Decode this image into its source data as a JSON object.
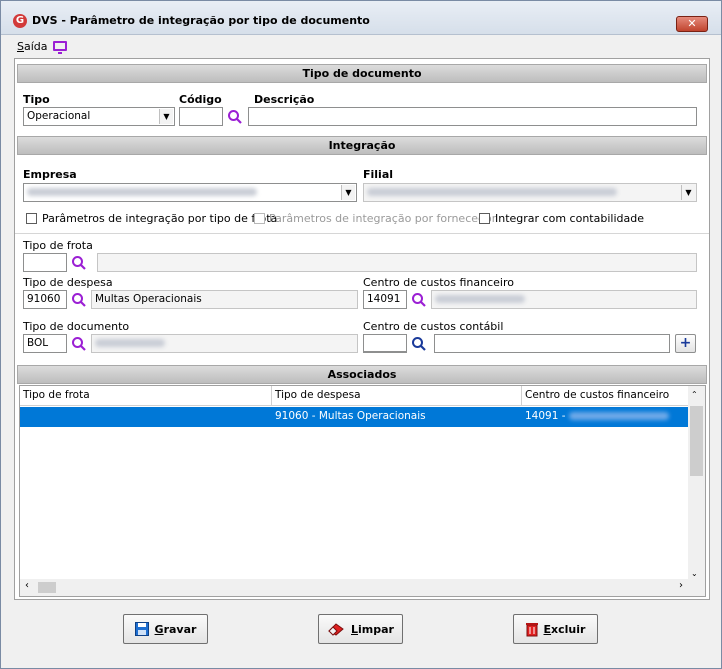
{
  "window": {
    "title": "DVS - Parâmetro de integração por tipo de documento",
    "close_glyph": "✕",
    "logo_glyph": "G"
  },
  "menu": {
    "saida": "Saída",
    "monitor_icon": "monitor-icon"
  },
  "tipo_documento_section": {
    "header": "Tipo de documento",
    "tipo_label": "Tipo",
    "tipo_value": "Operacional",
    "codigo_label": "Código",
    "codigo_value": "",
    "descricao_label": "Descrição",
    "descricao_value": ""
  },
  "integracao_section": {
    "header": "Integração",
    "empresa_label": "Empresa",
    "filial_label": "Filial",
    "chk_frota": "Parâmetros de integração por tipo de frota",
    "chk_fornecedor": "Parâmetros de integração por fornecedor",
    "chk_contabilidade": "Integrar com contabilidade",
    "tipo_frota_label": "Tipo de frota",
    "tipo_despesa_label": "Tipo de despesa",
    "tipo_despesa_code": "91060",
    "tipo_despesa_desc": "Multas Operacionais",
    "centro_fin_label": "Centro de custos financeiro",
    "centro_fin_code": "14091",
    "tipo_doc_label": "Tipo de documento",
    "tipo_doc_code": "BOL",
    "centro_cont_label": "Centro de custos contábil",
    "add_glyph": "+"
  },
  "associados_section": {
    "header": "Associados",
    "columns": [
      "Tipo de frota",
      "Tipo de despesa",
      "Centro de custos financeiro"
    ],
    "rows": [
      {
        "tipo_frota": "",
        "tipo_despesa": "91060 - Multas Operacionais",
        "centro_fin": "14091 -"
      }
    ]
  },
  "buttons": {
    "gravar": "Gravar",
    "limpar": "Limpar",
    "excluir": "Excluir"
  },
  "colors": {
    "selection": "#0078d7",
    "accent_icon": "#9b1fd4"
  }
}
